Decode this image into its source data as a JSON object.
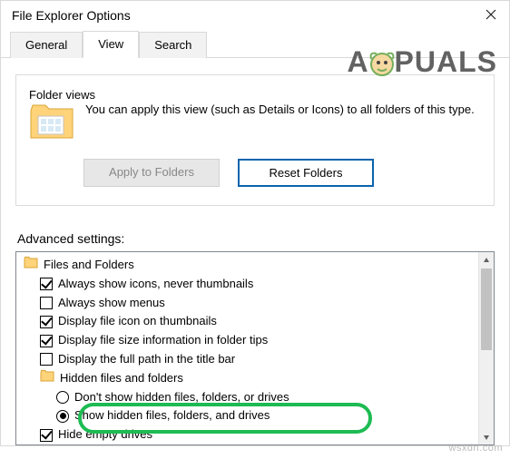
{
  "window": {
    "title": "File Explorer Options"
  },
  "tabs": {
    "general": "General",
    "view": "View",
    "search": "Search"
  },
  "folderViews": {
    "legend": "Folder views",
    "desc": "You can apply this view (such as Details or Icons) to all folders of this type.",
    "applyBtn": "Apply to Folders",
    "resetBtn": "Reset Folders"
  },
  "advanced": {
    "label": "Advanced settings:",
    "root": "Files and Folders",
    "opt_thumbs": "Always show icons, never thumbnails",
    "opt_menus": "Always show menus",
    "opt_fileicon": "Display file icon on thumbnails",
    "opt_sizetips": "Display file size information in folder tips",
    "opt_fullpath": "Display the full path in the title bar",
    "sub_hidden": "Hidden files and folders",
    "radio_dontshow": "Don't show hidden files, folders, or drives",
    "radio_show": "Show hidden files, folders, and drives",
    "opt_emptydrives": "Hide empty drives"
  },
  "watermark": {
    "pre": "A",
    "post": "PUALS"
  },
  "footer": {
    "mark": "wsxdn.com"
  }
}
